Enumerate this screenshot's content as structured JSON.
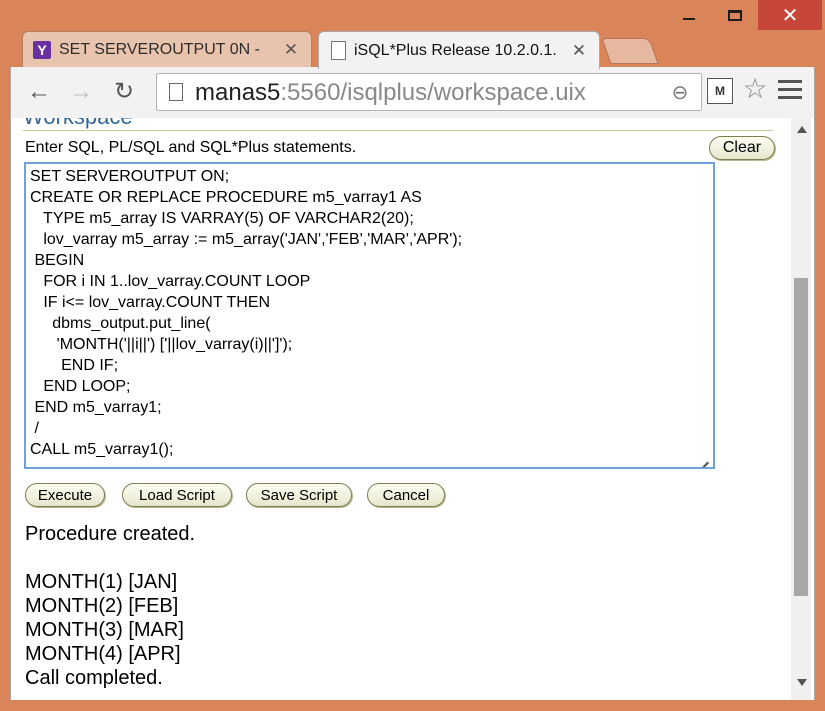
{
  "window": {
    "minimize_icon": "minimize-icon",
    "maximize_icon": "maximize-icon",
    "close_glyph": "✕"
  },
  "tabs": [
    {
      "title": "SET SERVEROUTPUT 0N -",
      "icon": "yahoo-icon",
      "icon_glyph": "Y",
      "close": "✕"
    },
    {
      "title": "iSQL*Plus Release 10.2.0.1.",
      "icon": "page-icon",
      "close": "✕"
    }
  ],
  "toolbar": {
    "back_glyph": "←",
    "forward_glyph": "→",
    "reload_glyph": "↻",
    "url_host": "manas5",
    "url_rest": ":5560/isqlplus/workspace.uix",
    "zoom_glyph": "⊖",
    "ext_glyph": "M",
    "star_glyph": "☆"
  },
  "workspace": {
    "heading": "Workspace",
    "instructions": "Enter SQL, PL/SQL and SQL*Plus statements.",
    "clear_label": "Clear",
    "sql_lines": [
      "SET SERVEROUTPUT ON;",
      "CREATE OR REPLACE PROCEDURE m5_varray1 AS",
      "   TYPE m5_array IS VARRAY(5) OF VARCHAR2(20);",
      "   lov_varray m5_array := m5_array('JAN','FEB','MAR','APR');",
      " BEGIN",
      "   FOR i IN 1..lov_varray.COUNT LOOP",
      "   IF i<= lov_varray.COUNT THEN",
      "     dbms_output.put_line(",
      "      'MONTH('||i||') ['||lov_varray(i)||']');",
      "       END IF;",
      "   END LOOP;",
      " END m5_varray1;",
      " /",
      "CALL m5_varray1();"
    ],
    "buttons": {
      "execute": "Execute",
      "load": "Load Script",
      "save": "Save Script",
      "cancel": "Cancel"
    },
    "output_lines": [
      "Procedure created.",
      "",
      "MONTH(1) [JAN]",
      "MONTH(2) [FEB]",
      "MONTH(3) [MAR]",
      "MONTH(4) [APR]",
      "Call completed."
    ]
  }
}
